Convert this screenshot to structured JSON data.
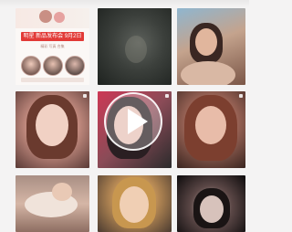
{
  "promo": {
    "title": "明星 新品发布会 9月2日",
    "subtitle": "精彩 写真 合集"
  },
  "video": {
    "play_icon": "play-icon"
  },
  "grid": {
    "tiles": [
      {
        "name": "tile-promo"
      },
      {
        "name": "tile-dark-photo"
      },
      {
        "name": "tile-outdoor-selfie"
      },
      {
        "name": "tile-portrait-1"
      },
      {
        "name": "tile-video"
      },
      {
        "name": "tile-portrait-2"
      },
      {
        "name": "tile-pet-photo"
      },
      {
        "name": "tile-portrait-3"
      },
      {
        "name": "tile-portrait-4"
      }
    ]
  },
  "colors": {
    "accent": "#e23a37",
    "page_bg": "#f4f3f3"
  }
}
